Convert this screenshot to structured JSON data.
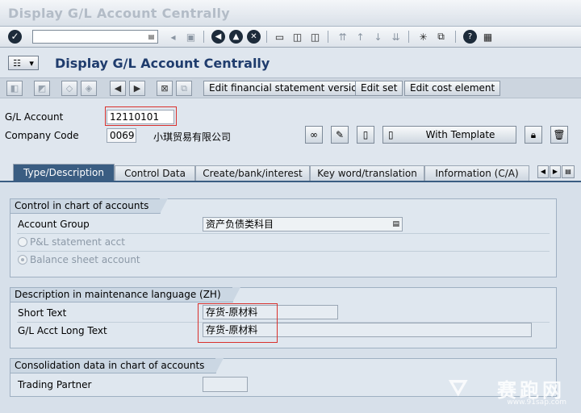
{
  "window": {
    "title": "Display G/L Account Centrally"
  },
  "toolbar": {
    "command_field_value": "",
    "icons": [
      "enter-icon",
      "back-icon",
      "exit-icon",
      "cancel-icon",
      "print-icon",
      "find-icon",
      "find-next-icon",
      "first-page-icon",
      "prev-page-icon",
      "next-page-icon",
      "last-page-icon",
      "new-session-icon",
      "shortcut-icon",
      "help-icon",
      "customize-icon"
    ]
  },
  "screen": {
    "title": "Display G/L Account Centrally"
  },
  "app_toolbar": {
    "buttons": {
      "fs_version": "Edit financial statement version",
      "edit_set": "Edit set",
      "cost_element": "Edit cost element"
    }
  },
  "header": {
    "gl_account_label": "G/L Account",
    "gl_account_value": "12110101",
    "company_code_label": "Company Code",
    "company_code_value": "0069",
    "company_name": "小琪贸易有限公司",
    "with_template": "With Template"
  },
  "tabs": [
    {
      "label": "Type/Description",
      "active": true
    },
    {
      "label": "Control Data",
      "active": false
    },
    {
      "label": "Create/bank/interest",
      "active": false
    },
    {
      "label": "Key word/translation",
      "active": false
    },
    {
      "label": "Information (C/A)",
      "active": false
    }
  ],
  "groups": {
    "control": {
      "title": "Control in chart of accounts",
      "account_group_label": "Account Group",
      "account_group_value": "资产负债类科目",
      "pl_label": "P&L statement acct",
      "bs_label": "Balance sheet account",
      "selected": "Balance sheet account"
    },
    "description": {
      "title": "Description in maintenance language (ZH)",
      "short_text_label": "Short Text",
      "short_text_value": "存货-原材料",
      "long_text_label": "G/L Acct Long Text",
      "long_text_value": "存货-原材料"
    },
    "consolidation": {
      "title": "Consolidation data in chart of accounts",
      "trading_partner_label": "Trading Partner",
      "trading_partner_value": ""
    }
  },
  "watermark": {
    "text": "赛跑网",
    "url": "www.91sap.com"
  },
  "colors": {
    "title_blue": "#1f3c6d",
    "active_tab": "#3a5d82",
    "highlight_red": "#d9302c"
  }
}
